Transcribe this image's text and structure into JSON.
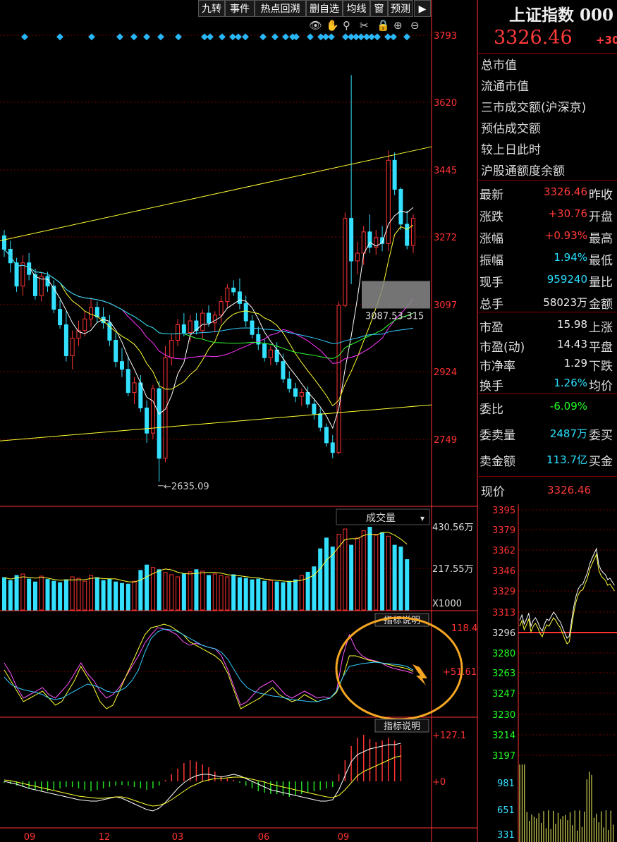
{
  "toolbar": {
    "buttons": [
      "九转",
      "事件",
      "热点回溯",
      "删自选",
      "均线",
      "窗",
      "预测"
    ],
    "tools": [
      "eye-icon",
      "hand-icon",
      "cut-icon",
      "scissors-icon",
      "lock-icon",
      "zoom-in-icon",
      "zoom-out-icon"
    ]
  },
  "chart_data": [
    {
      "type": "candlestick",
      "ylim": [
        2650,
        3793
      ],
      "yticks": [
        "3793",
        "3620",
        "3445",
        "3272",
        "3097",
        "2924",
        "2749"
      ],
      "xticks": [
        "09",
        "12",
        "03",
        "06",
        "09"
      ],
      "annotations": {
        "low": "2635.09",
        "gap": "3087.53-315"
      },
      "candles": [
        [
          3275,
          3290,
          3220,
          3240
        ],
        [
          3240,
          3262,
          3180,
          3205
        ],
        [
          3205,
          3218,
          3130,
          3145
        ],
        [
          3145,
          3225,
          3120,
          3205
        ],
        [
          3205,
          3230,
          3160,
          3175
        ],
        [
          3175,
          3190,
          3110,
          3120
        ],
        [
          3120,
          3180,
          3105,
          3170
        ],
        [
          3170,
          3182,
          3130,
          3145
        ],
        [
          3145,
          3160,
          3075,
          3085
        ],
        [
          3085,
          3110,
          3035,
          3045
        ],
        [
          3045,
          3080,
          2950,
          2965
        ],
        [
          2965,
          3030,
          2930,
          3010
        ],
        [
          3010,
          3055,
          2990,
          3030
        ],
        [
          3030,
          3080,
          3015,
          3060
        ],
        [
          3060,
          3115,
          3040,
          3090
        ],
        [
          3090,
          3105,
          3050,
          3065
        ],
        [
          3065,
          3090,
          3035,
          3050
        ],
        [
          3050,
          3070,
          2990,
          3005
        ],
        [
          3005,
          3025,
          2935,
          2950
        ],
        [
          2950,
          2985,
          2910,
          2930
        ],
        [
          2930,
          2965,
          2860,
          2870
        ],
        [
          2870,
          2910,
          2840,
          2895
        ],
        [
          2895,
          2915,
          2820,
          2830
        ],
        [
          2830,
          2850,
          2740,
          2765
        ],
        [
          2765,
          2890,
          2750,
          2880
        ],
        [
          2880,
          2900,
          2640,
          2700
        ],
        [
          2700,
          2990,
          2690,
          2960
        ],
        [
          2960,
          3020,
          2940,
          3005
        ],
        [
          3005,
          3060,
          2990,
          3045
        ],
        [
          3045,
          3075,
          3015,
          3025
        ],
        [
          3025,
          3070,
          3000,
          3055
        ],
        [
          3055,
          3075,
          3020,
          3030
        ],
        [
          3030,
          3085,
          3010,
          3075
        ],
        [
          3075,
          3095,
          3040,
          3050
        ],
        [
          3050,
          3080,
          3025,
          3070
        ],
        [
          3070,
          3120,
          3050,
          3105
        ],
        [
          3105,
          3150,
          3090,
          3140
        ],
        [
          3140,
          3160,
          3120,
          3130
        ],
        [
          3130,
          3165,
          3085,
          3100
        ],
        [
          3100,
          3120,
          3040,
          3055
        ],
        [
          3055,
          3070,
          3010,
          3020
        ],
        [
          3020,
          3040,
          2980,
          2995
        ],
        [
          2995,
          3010,
          2950,
          2960
        ],
        [
          2960,
          2990,
          2940,
          2980
        ],
        [
          2980,
          3000,
          2940,
          2950
        ],
        [
          2950,
          2970,
          2895,
          2905
        ],
        [
          2905,
          2925,
          2870,
          2880
        ],
        [
          2880,
          2895,
          2845,
          2860
        ],
        [
          2860,
          2880,
          2835,
          2870
        ],
        [
          2870,
          2885,
          2830,
          2840
        ],
        [
          2840,
          2855,
          2800,
          2815
        ],
        [
          2815,
          2830,
          2770,
          2780
        ],
        [
          2780,
          2790,
          2730,
          2740
        ],
        [
          2740,
          2760,
          2700,
          2715
        ],
        [
          2715,
          3105,
          2710,
          3095
        ],
        [
          3095,
          3335,
          3090,
          3320
        ],
        [
          3320,
          3690,
          3150,
          3210
        ],
        [
          3210,
          3260,
          3175,
          3230
        ],
        [
          3230,
          3300,
          3200,
          3285
        ],
        [
          3285,
          3330,
          3230,
          3245
        ],
        [
          3245,
          3290,
          3225,
          3270
        ],
        [
          3270,
          3300,
          3235,
          3255
        ],
        [
          3255,
          3495,
          3235,
          3470
        ],
        [
          3470,
          3490,
          3380,
          3395
        ],
        [
          3395,
          3400,
          3290,
          3305
        ],
        [
          3305,
          3340,
          3240,
          3250
        ],
        [
          3250,
          3330,
          3230,
          3320
        ]
      ]
    },
    {
      "type": "bar",
      "name": "成交量",
      "yticks": [
        "430.56万",
        "217.55万",
        "X1000"
      ],
      "values": [
        90,
        82,
        96,
        100,
        86,
        78,
        94,
        85,
        80,
        76,
        84,
        92,
        88,
        80,
        96,
        90,
        82,
        86,
        78,
        74,
        72,
        80,
        110,
        125,
        118,
        112,
        104,
        98,
        92,
        100,
        106,
        112,
        108,
        96,
        100,
        95,
        92,
        98,
        90,
        88,
        84,
        86,
        80,
        82,
        78,
        76,
        80,
        84,
        96,
        105,
        120,
        170,
        200,
        175,
        210,
        225,
        180,
        200,
        220,
        230,
        210,
        215,
        205,
        180,
        175,
        140
      ]
    },
    {
      "type": "line",
      "yticks": [
        "118.4",
        "+51.61"
      ],
      "button": "指标说明"
    },
    {
      "type": "bar",
      "yticks": [
        "+127.1",
        "+0"
      ],
      "button": "指标说明"
    },
    {
      "type": "line",
      "name": "intraday",
      "yticks": [
        "3395",
        "3379",
        "3362",
        "3346",
        "3329",
        "3313",
        "3296",
        "3280",
        "3263",
        "3247",
        "3230",
        "3214",
        "3197"
      ],
      "vol_ticks": [
        "981",
        "651",
        "331"
      ],
      "price_label": "现价",
      "price_value": "3326.46"
    }
  ],
  "panel": {
    "title": "上证指数 000",
    "price": "3326.46",
    "change_partial": "+30",
    "info_labels": [
      "总市值",
      "流通市值",
      "三市成交额(沪深京)",
      "预估成交额",
      "较上日此时",
      "沪股通额度余额"
    ],
    "quote_rows": [
      {
        "k": "最新",
        "v": "3326.46",
        "c": "red",
        "k2": "昨收"
      },
      {
        "k": "涨跌",
        "v": "+30.76",
        "c": "red",
        "k2": "开盘"
      },
      {
        "k": "涨幅",
        "v": "+0.93%",
        "c": "red",
        "k2": "最高"
      },
      {
        "k": "振幅",
        "v": "1.94%",
        "c": "cyan",
        "k2": "最低"
      },
      {
        "k": "现手",
        "v": "959240",
        "c": "cyan",
        "k2": "量比"
      },
      {
        "k": "总手",
        "v": "58023万",
        "c": "wht",
        "k2": "金额"
      }
    ],
    "val_rows": [
      {
        "k": "市盈",
        "v": "15.98",
        "c": "wht",
        "k2": "上涨"
      },
      {
        "k": "市盈(动)",
        "v": "14.43",
        "c": "wht",
        "k2": "平盘"
      },
      {
        "k": "市净率",
        "v": "1.29",
        "c": "wht",
        "k2": "下跌"
      },
      {
        "k": "换手",
        "v": "1.26%",
        "c": "cyan",
        "k2": "均价"
      }
    ],
    "order_rows": [
      {
        "k": "委比",
        "v": "-6.09%",
        "c": "green",
        "k2": ""
      },
      {
        "k": "委卖量",
        "v": "2487万",
        "c": "cyan",
        "k2": "委买"
      },
      {
        "k": "卖金额",
        "v": "113.7亿",
        "c": "cyan",
        "k2": "买金"
      }
    ]
  }
}
